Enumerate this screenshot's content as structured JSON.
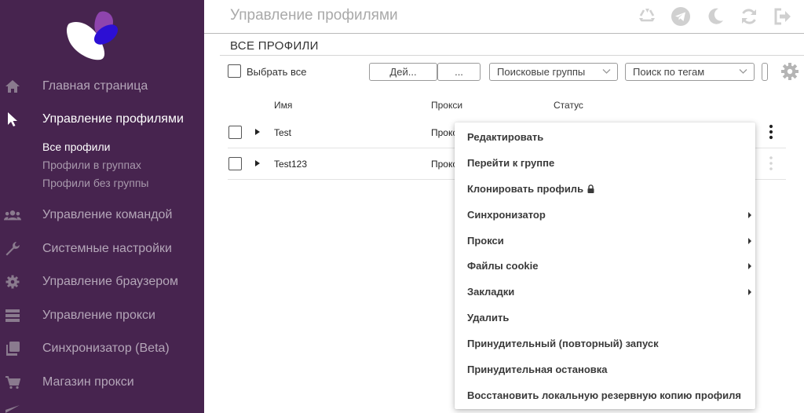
{
  "colors": {
    "sidebar_bg": "#47244f",
    "logo_purple": "#8e44ad",
    "logo_blue": "#2c0fd4",
    "sidebar_text": "#b4a6b8",
    "active_text": "#ffffff"
  },
  "sidebar": {
    "items": [
      {
        "label": "Главная страница",
        "icon": "home-icon",
        "active": false
      },
      {
        "label": "Управление профилями",
        "icon": "cursor-icon",
        "active": true
      },
      {
        "label": "Управление командой",
        "icon": "team-icon",
        "active": false
      },
      {
        "label": "Системные настройки",
        "icon": "wrench-icon",
        "active": false
      },
      {
        "label": "Управление браузером",
        "icon": "gear-icon",
        "active": false
      },
      {
        "label": "Управление прокси",
        "icon": "server-icon",
        "active": false
      },
      {
        "label": "Синхронизатор (Beta)",
        "icon": "copy-icon",
        "active": false
      },
      {
        "label": "Магазин прокси",
        "icon": "cart-icon",
        "active": false
      }
    ],
    "subitems": [
      {
        "label": "Все профили",
        "active": true
      },
      {
        "label": "Профили в группах",
        "active": false
      },
      {
        "label": "Профили без группы",
        "active": false
      }
    ]
  },
  "header": {
    "title": "Управление профилями",
    "icons": [
      "recycle-icon",
      "telegram-icon",
      "moon-icon",
      "refresh-icon",
      "logout-icon"
    ]
  },
  "main": {
    "section_title": "ВСЕ ПРОФИЛИ",
    "select_all_label": "Выбрать все",
    "actions_button": "Дей...",
    "more_button": "...",
    "search_groups_placeholder": "Поисковые группы",
    "search_tags_placeholder": "Поиск по тегам",
    "columns": [
      "Имя",
      "Прокси",
      "Статус"
    ],
    "rows": [
      {
        "name": "Test",
        "proxy": "Прокс"
      },
      {
        "name": "Test123",
        "proxy": "Прокс"
      }
    ]
  },
  "context_menu": {
    "items": [
      {
        "label": "Редактировать",
        "submenu": false,
        "locked": false
      },
      {
        "label": "Перейти к группе",
        "submenu": false,
        "locked": false
      },
      {
        "label": "Клонировать профиль",
        "submenu": false,
        "locked": true
      },
      {
        "label": "Синхронизатор",
        "submenu": true,
        "locked": false
      },
      {
        "label": "Прокси",
        "submenu": true,
        "locked": false
      },
      {
        "label": "Файлы cookie",
        "submenu": true,
        "locked": false
      },
      {
        "label": "Закладки",
        "submenu": true,
        "locked": false
      },
      {
        "label": "Удалить",
        "submenu": false,
        "locked": false
      },
      {
        "label": "Принудительный (повторный) запуск",
        "submenu": false,
        "locked": false
      },
      {
        "label": "Принудительная остановка",
        "submenu": false,
        "locked": false
      },
      {
        "label": "Восстановить локальную резервную копию профиля",
        "submenu": false,
        "locked": false
      }
    ]
  }
}
